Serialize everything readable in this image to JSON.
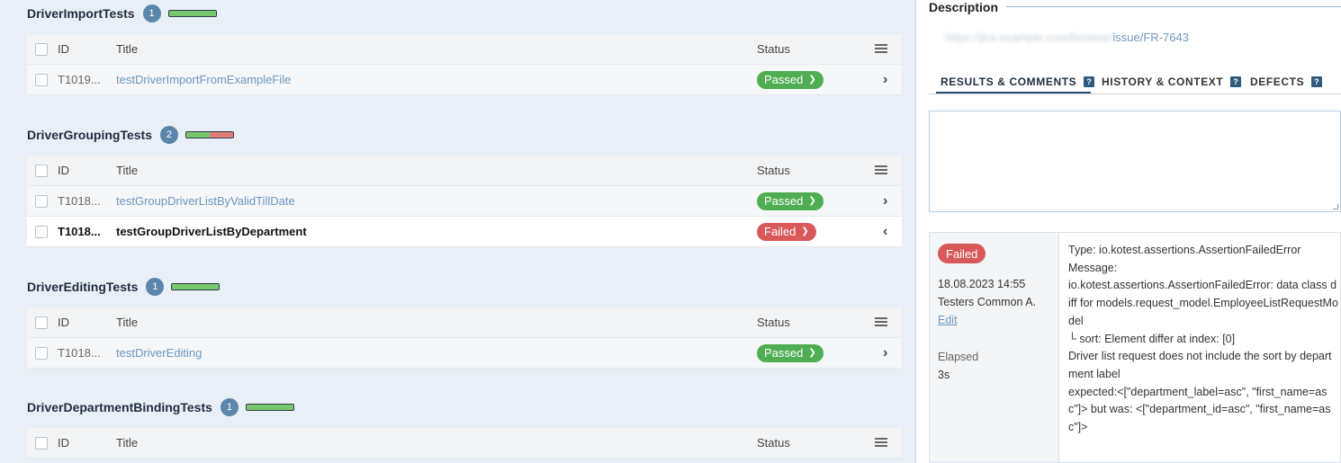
{
  "columns": {
    "id": "ID",
    "title": "Title",
    "status": "Status"
  },
  "colors": {
    "passed": "#4fad54",
    "failed": "#d9595a",
    "link": "#6d97bd",
    "count_badge": "#5b86ab"
  },
  "groups": [
    {
      "name": "DriverImportTests",
      "count": "1",
      "pass_fraction": 1.0,
      "rows": [
        {
          "id": "T1019...",
          "title": "testDriverImportFromExampleFile",
          "status": "Passed"
        }
      ]
    },
    {
      "name": "DriverGroupingTests",
      "count": "2",
      "pass_fraction": 0.5,
      "rows": [
        {
          "id": "T1018...",
          "title": "testGroupDriverListByValidTillDate",
          "status": "Passed"
        },
        {
          "id": "T1018...",
          "title": "testGroupDriverListByDepartment",
          "status": "Failed"
        }
      ]
    },
    {
      "name": "DriverEditingTests",
      "count": "1",
      "pass_fraction": 1.0,
      "rows": [
        {
          "id": "T1018...",
          "title": "testDriverEditing",
          "status": "Passed"
        }
      ]
    },
    {
      "name": "DriverDepartmentBindingTests",
      "count": "1",
      "pass_fraction": 1.0,
      "rows": []
    }
  ],
  "detail": {
    "description_label": "Description",
    "link_blurred": "https://jira.example.com/browse/",
    "link_suffix": "issue/FR-7643",
    "tabs": [
      {
        "label": "RESULTS & COMMENTS",
        "help": "?"
      },
      {
        "label": "HISTORY & CONTEXT",
        "help": "?"
      },
      {
        "label": "DEFECTS",
        "help": "?"
      }
    ],
    "result": {
      "status": "Failed",
      "date": "18.08.2023 14:55",
      "author": "Testers Common A.",
      "edit": "Edit",
      "elapsed_label": "Elapsed",
      "elapsed_value": "3s",
      "text": "Type: io.kotest.assertions.AssertionFailedError\nMessage:\nio.kotest.assertions.AssertionFailedError: data class diff for models.request_model.EmployeeListRequestModel\n└ sort: Element differ at index: [0]\nDriver list request does not include the sort by department label\nexpected:<[\"department_label=asc\", \"first_name=asc\"]> but was: <[\"department_id=asc\", \"first_name=asc\"]>"
    }
  }
}
